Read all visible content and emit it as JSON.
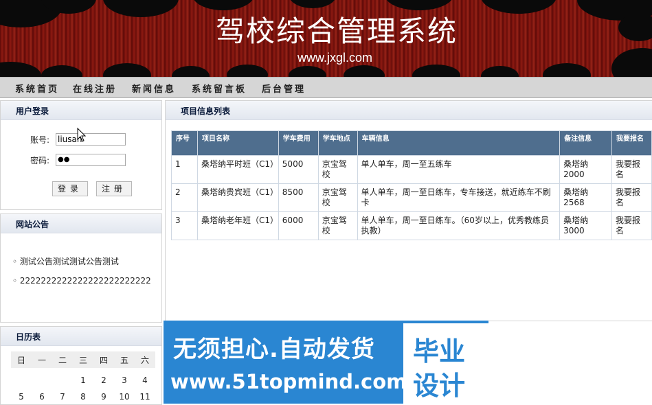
{
  "header": {
    "title": "驾校综合管理系统",
    "url": "www.jxgl.com"
  },
  "nav": [
    {
      "label": "系统首页"
    },
    {
      "label": "在线注册"
    },
    {
      "label": "新闻信息"
    },
    {
      "label": "系统留言板"
    },
    {
      "label": "后台管理"
    }
  ],
  "login": {
    "title": "用户登录",
    "account_label": "账号:",
    "account_value": "liusan",
    "password_label": "密码:",
    "password_mask": "●●",
    "login_button": "登录",
    "register_button": "注册"
  },
  "notice": {
    "title": "网站公告",
    "items": [
      {
        "text": "◦ 测试公告测试测试公告测试"
      },
      {
        "text": "◦ 2222222222222222222222222"
      }
    ]
  },
  "calendar": {
    "title": "日历表",
    "weekdays": [
      "日",
      "一",
      "二",
      "三",
      "四",
      "五",
      "六"
    ],
    "row1": [
      "",
      "",
      "",
      "1",
      "2",
      "3",
      "4"
    ],
    "row2": [
      "5",
      "6",
      "7",
      "8",
      "9",
      "10",
      "11"
    ]
  },
  "projects": {
    "title": "项目信息列表",
    "headers": [
      "序号",
      "项目名称",
      "学车费用",
      "学车地点",
      "车辆信息",
      "备注信息",
      "我要报名"
    ],
    "rows": [
      [
        "1",
        "桑塔纳平时班（C1）",
        "5000",
        "京宝驾校",
        "单人单车，周一至五练车",
        "桑塔纳2000",
        "我要报名"
      ],
      [
        "2",
        "桑塔纳贵宾班（C1）",
        "8500",
        "京宝驾校",
        "单人单车，周一至日练车，专车接送，就近练车不刷卡",
        "桑塔纳2568",
        "我要报名"
      ],
      [
        "3",
        "桑塔纳老年班（C1）",
        "6000",
        "京宝驾校",
        "单人单车，周一至日练车。（60岁以上，优秀教练员执教）",
        "桑塔纳3000",
        "我要报名"
      ]
    ]
  },
  "ad": {
    "line1": "无须担心.自动发货",
    "line2": "www.51topmind.com",
    "box_line1": "毕业",
    "box_line2": "设计"
  },
  "colors": {
    "nav_bg": "#d6d6d6",
    "table_header": "#4f6e8e",
    "banner": "#7a1410",
    "ad_blue": "#2a86d2"
  }
}
